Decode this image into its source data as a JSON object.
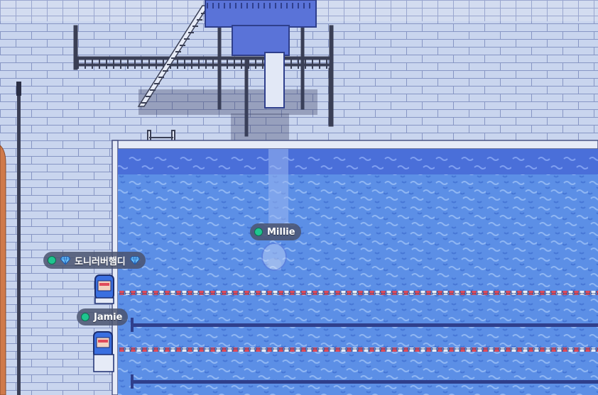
{
  "colors": {
    "wall": "#c9d5ee",
    "brick_line": "#8796c4",
    "pool_water": "#5c8fe6",
    "pool_water_dark": "#3d63c8",
    "rope_red": "#e04a5a",
    "rope_white": "#e8eef8",
    "lane_line": "#2f3f8c",
    "diving_board": "#5a73d8",
    "online_dot": "#1fc58f",
    "nametag_bg": "#4a546e"
  },
  "players": [
    {
      "name": "도니러버햄디",
      "status": "online",
      "badges": [
        "diamond-icon",
        "diamond-icon"
      ]
    },
    {
      "name": "Millie",
      "status": "online",
      "badges": []
    },
    {
      "name": "Jamie",
      "status": "online",
      "badges": []
    }
  ]
}
